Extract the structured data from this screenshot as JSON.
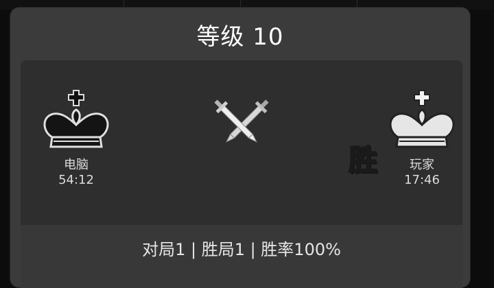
{
  "dialog": {
    "title": "等级 10"
  },
  "players": {
    "left": {
      "name": "电脑",
      "time": "54:12",
      "piece": "black-king-icon"
    },
    "right": {
      "name": "玩家",
      "time": "17:46",
      "piece": "white-king-icon",
      "badge": "胜"
    }
  },
  "versus_icon": "crossed-swords-icon",
  "stats": {
    "text": "对局1 | 胜局1 | 胜率100%"
  },
  "colors": {
    "dialog_bg": "#3b3b3b",
    "panel_bg": "#2e2e2e",
    "stats_bg": "#383838",
    "text": "#ffffff"
  }
}
